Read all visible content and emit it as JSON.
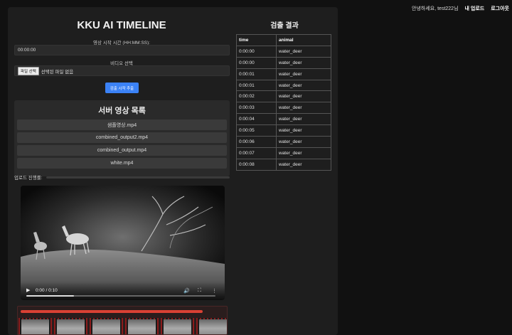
{
  "topnav": {
    "greeting": "안녕하세요, test222님",
    "my_upload": "내 업로드",
    "logout": "로그아웃"
  },
  "app": {
    "title": "KKU AI TIMELINE"
  },
  "form": {
    "start_time_label": "영상 시작 시간 (HH:MM:SS):",
    "start_time_value": "00:00:00",
    "video_select_label": "비디오 선택",
    "file_button": "파일 선택",
    "file_status": "선택된 파일 없음",
    "extract_button": "검출 시작 추출"
  },
  "server_videos": {
    "title": "서버 영상 목록",
    "items": [
      "샘플영상.mp4",
      "combined_output2.mp4",
      "combined_output.mp4",
      "white.mp4"
    ]
  },
  "upload": {
    "progress_label": "업로드 진행률:",
    "progress": 0
  },
  "player": {
    "time_display": "0:00 / 0:10",
    "progress": 0.25
  },
  "filmstrip": {
    "frame_count": 6
  },
  "detection": {
    "title": "검출 결과",
    "columns": [
      "time",
      "animal"
    ],
    "rows": [
      [
        "0:00:00",
        "water_deer"
      ],
      [
        "0:00:00",
        "water_deer"
      ],
      [
        "0:00:01",
        "water_deer"
      ],
      [
        "0:00:01",
        "water_deer"
      ],
      [
        "0:00:02",
        "water_deer"
      ],
      [
        "0:00:03",
        "water_deer"
      ],
      [
        "0:00:04",
        "water_deer"
      ],
      [
        "0:00:05",
        "water_deer"
      ],
      [
        "0:00:06",
        "water_deer"
      ],
      [
        "0:00:07",
        "water_deer"
      ],
      [
        "0:00:08",
        "water_deer"
      ]
    ]
  },
  "colors": {
    "accent": "#3b82f6",
    "progress_red": "#d94134",
    "panel_bg": "#1e1e1e",
    "page_bg": "#111111"
  }
}
